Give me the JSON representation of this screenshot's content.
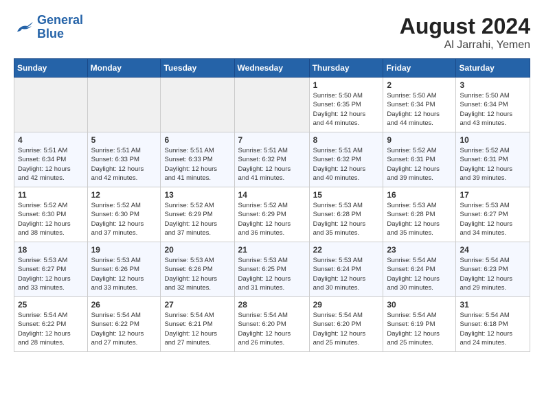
{
  "logo": {
    "line1": "General",
    "line2": "Blue"
  },
  "title": {
    "month_year": "August 2024",
    "location": "Al Jarrahi, Yemen"
  },
  "headers": [
    "Sunday",
    "Monday",
    "Tuesday",
    "Wednesday",
    "Thursday",
    "Friday",
    "Saturday"
  ],
  "weeks": [
    [
      {
        "day": "",
        "info": ""
      },
      {
        "day": "",
        "info": ""
      },
      {
        "day": "",
        "info": ""
      },
      {
        "day": "",
        "info": ""
      },
      {
        "day": "1",
        "info": "Sunrise: 5:50 AM\nSunset: 6:35 PM\nDaylight: 12 hours\nand 44 minutes."
      },
      {
        "day": "2",
        "info": "Sunrise: 5:50 AM\nSunset: 6:34 PM\nDaylight: 12 hours\nand 44 minutes."
      },
      {
        "day": "3",
        "info": "Sunrise: 5:50 AM\nSunset: 6:34 PM\nDaylight: 12 hours\nand 43 minutes."
      }
    ],
    [
      {
        "day": "4",
        "info": "Sunrise: 5:51 AM\nSunset: 6:34 PM\nDaylight: 12 hours\nand 42 minutes."
      },
      {
        "day": "5",
        "info": "Sunrise: 5:51 AM\nSunset: 6:33 PM\nDaylight: 12 hours\nand 42 minutes."
      },
      {
        "day": "6",
        "info": "Sunrise: 5:51 AM\nSunset: 6:33 PM\nDaylight: 12 hours\nand 41 minutes."
      },
      {
        "day": "7",
        "info": "Sunrise: 5:51 AM\nSunset: 6:32 PM\nDaylight: 12 hours\nand 41 minutes."
      },
      {
        "day": "8",
        "info": "Sunrise: 5:51 AM\nSunset: 6:32 PM\nDaylight: 12 hours\nand 40 minutes."
      },
      {
        "day": "9",
        "info": "Sunrise: 5:52 AM\nSunset: 6:31 PM\nDaylight: 12 hours\nand 39 minutes."
      },
      {
        "day": "10",
        "info": "Sunrise: 5:52 AM\nSunset: 6:31 PM\nDaylight: 12 hours\nand 39 minutes."
      }
    ],
    [
      {
        "day": "11",
        "info": "Sunrise: 5:52 AM\nSunset: 6:30 PM\nDaylight: 12 hours\nand 38 minutes."
      },
      {
        "day": "12",
        "info": "Sunrise: 5:52 AM\nSunset: 6:30 PM\nDaylight: 12 hours\nand 37 minutes."
      },
      {
        "day": "13",
        "info": "Sunrise: 5:52 AM\nSunset: 6:29 PM\nDaylight: 12 hours\nand 37 minutes."
      },
      {
        "day": "14",
        "info": "Sunrise: 5:52 AM\nSunset: 6:29 PM\nDaylight: 12 hours\nand 36 minutes."
      },
      {
        "day": "15",
        "info": "Sunrise: 5:53 AM\nSunset: 6:28 PM\nDaylight: 12 hours\nand 35 minutes."
      },
      {
        "day": "16",
        "info": "Sunrise: 5:53 AM\nSunset: 6:28 PM\nDaylight: 12 hours\nand 35 minutes."
      },
      {
        "day": "17",
        "info": "Sunrise: 5:53 AM\nSunset: 6:27 PM\nDaylight: 12 hours\nand 34 minutes."
      }
    ],
    [
      {
        "day": "18",
        "info": "Sunrise: 5:53 AM\nSunset: 6:27 PM\nDaylight: 12 hours\nand 33 minutes."
      },
      {
        "day": "19",
        "info": "Sunrise: 5:53 AM\nSunset: 6:26 PM\nDaylight: 12 hours\nand 33 minutes."
      },
      {
        "day": "20",
        "info": "Sunrise: 5:53 AM\nSunset: 6:26 PM\nDaylight: 12 hours\nand 32 minutes."
      },
      {
        "day": "21",
        "info": "Sunrise: 5:53 AM\nSunset: 6:25 PM\nDaylight: 12 hours\nand 31 minutes."
      },
      {
        "day": "22",
        "info": "Sunrise: 5:53 AM\nSunset: 6:24 PM\nDaylight: 12 hours\nand 30 minutes."
      },
      {
        "day": "23",
        "info": "Sunrise: 5:54 AM\nSunset: 6:24 PM\nDaylight: 12 hours\nand 30 minutes."
      },
      {
        "day": "24",
        "info": "Sunrise: 5:54 AM\nSunset: 6:23 PM\nDaylight: 12 hours\nand 29 minutes."
      }
    ],
    [
      {
        "day": "25",
        "info": "Sunrise: 5:54 AM\nSunset: 6:22 PM\nDaylight: 12 hours\nand 28 minutes."
      },
      {
        "day": "26",
        "info": "Sunrise: 5:54 AM\nSunset: 6:22 PM\nDaylight: 12 hours\nand 27 minutes."
      },
      {
        "day": "27",
        "info": "Sunrise: 5:54 AM\nSunset: 6:21 PM\nDaylight: 12 hours\nand 27 minutes."
      },
      {
        "day": "28",
        "info": "Sunrise: 5:54 AM\nSunset: 6:20 PM\nDaylight: 12 hours\nand 26 minutes."
      },
      {
        "day": "29",
        "info": "Sunrise: 5:54 AM\nSunset: 6:20 PM\nDaylight: 12 hours\nand 25 minutes."
      },
      {
        "day": "30",
        "info": "Sunrise: 5:54 AM\nSunset: 6:19 PM\nDaylight: 12 hours\nand 25 minutes."
      },
      {
        "day": "31",
        "info": "Sunrise: 5:54 AM\nSunset: 6:18 PM\nDaylight: 12 hours\nand 24 minutes."
      }
    ]
  ]
}
